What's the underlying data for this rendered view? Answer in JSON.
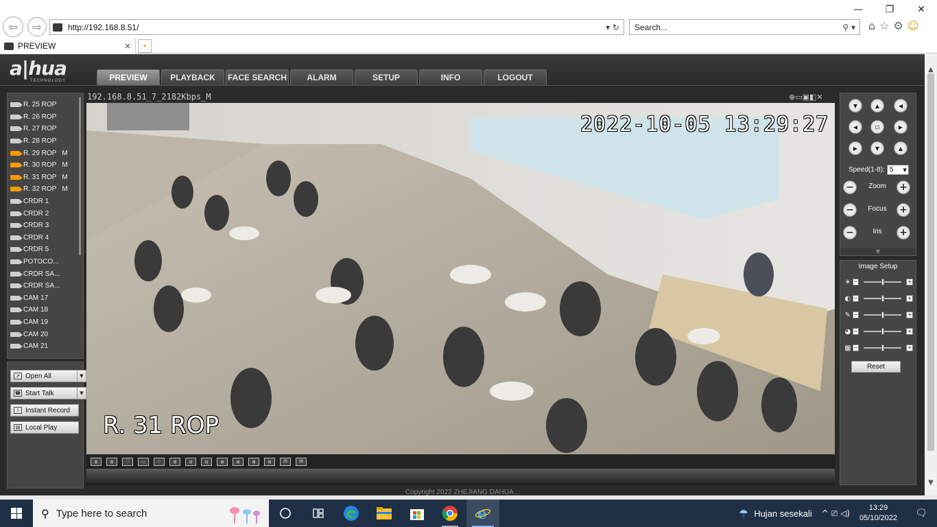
{
  "browser": {
    "address": "http://192.168.8.51/",
    "search_placeholder": "Search...",
    "tab_title": "PREVIEW",
    "window_controls": {
      "minimize": "—",
      "restore": "❐",
      "close": "✕"
    },
    "nav_back": "⇦",
    "nav_forward": "⇨",
    "addr_actions": "▾  ↻",
    "search_actions": "⚲ ▾",
    "tools": {
      "home": "⌂",
      "favorites": "☆",
      "settings": "⚙",
      "feedback": "☺"
    },
    "tab_close": "×"
  },
  "app": {
    "logo": "a|hua",
    "logo_sub": "TECHNOLOGY",
    "menu": [
      {
        "label": "PREVIEW",
        "active": true
      },
      {
        "label": "PLAYBACK"
      },
      {
        "label": "FACE SEARCH"
      },
      {
        "label": "ALARM"
      },
      {
        "label": "SETUP"
      },
      {
        "label": "INFO"
      },
      {
        "label": "LOGOUT"
      }
    ]
  },
  "channels": [
    {
      "name": "R. 25 ROP",
      "open": false,
      "m": ""
    },
    {
      "name": "R. 26 ROP",
      "open": false,
      "m": ""
    },
    {
      "name": "R. 27 ROP",
      "open": false,
      "m": ""
    },
    {
      "name": "R. 28 ROP",
      "open": false,
      "m": ""
    },
    {
      "name": "R. 29 ROP",
      "open": true,
      "m": "M"
    },
    {
      "name": "R. 30 ROP",
      "open": true,
      "m": "M"
    },
    {
      "name": "R. 31 ROP",
      "open": true,
      "m": "M"
    },
    {
      "name": "R. 32 ROP",
      "open": true,
      "m": "M"
    },
    {
      "name": "CRDR 1",
      "open": false,
      "m": ""
    },
    {
      "name": "CRDR 2",
      "open": false,
      "m": ""
    },
    {
      "name": "CRDR 3",
      "open": false,
      "m": ""
    },
    {
      "name": "CRDR 4",
      "open": false,
      "m": ""
    },
    {
      "name": "CRDR 5",
      "open": false,
      "m": ""
    },
    {
      "name": "POTOCO...",
      "open": false,
      "m": ""
    },
    {
      "name": "CRDR SA...",
      "open": false,
      "m": ""
    },
    {
      "name": "CRDR SA...",
      "open": false,
      "m": ""
    },
    {
      "name": "CAM 17",
      "open": false,
      "m": ""
    },
    {
      "name": "CAM 18",
      "open": false,
      "m": ""
    },
    {
      "name": "CAM 19",
      "open": false,
      "m": ""
    },
    {
      "name": "CAM 20",
      "open": false,
      "m": ""
    },
    {
      "name": "CAM 21",
      "open": false,
      "m": ""
    }
  ],
  "controls": {
    "open_all": "Open All",
    "start_talk": "Start Talk",
    "instant_record": "Instant Record",
    "local_play": "Local Play"
  },
  "video": {
    "stream_title": "192.168.8.51_7_2182Kbps_M",
    "timestamp": "2022-10-05 13:29:27",
    "channel_osd": "R. 31 ROP",
    "toolbar_icons": "⊕▭▣◧✕"
  },
  "layouts": [
    "⊞",
    "⊞",
    "⛶",
    "▭",
    "□",
    "⊞",
    "⊟",
    "⊟",
    "⊞",
    "⊞",
    "⊞",
    "⊞",
    "25",
    "36"
  ],
  "ptz": {
    "speed_label": "Speed(1-8):",
    "speed_value": "5",
    "zoom_label": "Zoom",
    "focus_label": "Focus",
    "iris_label": "Iris"
  },
  "image_setup": {
    "title": "Image Setup",
    "sliders": [
      {
        "icon": "☀",
        "level": 0.5
      },
      {
        "icon": "◐",
        "level": 0.5
      },
      {
        "icon": "✎",
        "level": 0.5
      },
      {
        "icon": "◕",
        "level": 0.5
      },
      {
        "icon": "▦",
        "level": 0.5
      }
    ],
    "reset_label": "Reset"
  },
  "footer": "Copyright 2022 ZHEJIANG DAHUA...",
  "taskbar": {
    "search_text": "Type here to search",
    "weather": "Hujan sesekali",
    "time": "13:29",
    "date": "05/10/2022",
    "tray_icons": "^ ⎚ ◁)"
  }
}
